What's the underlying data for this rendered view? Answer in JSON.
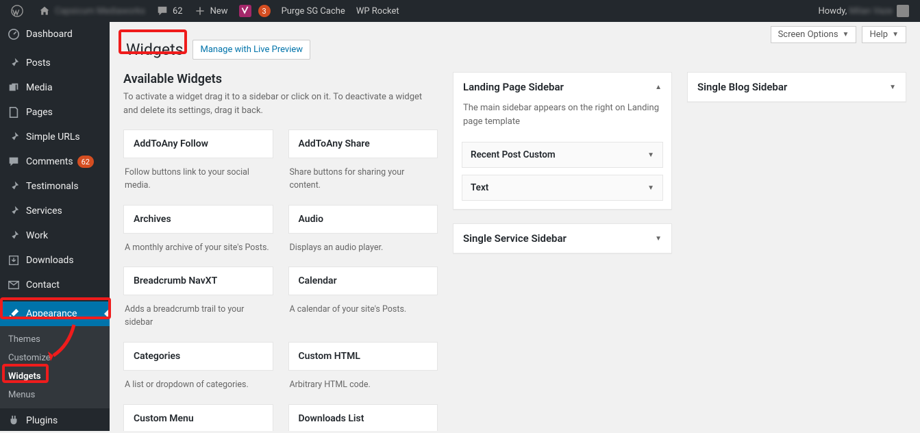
{
  "adminbar": {
    "site_name": "Capsicum Mediaworks",
    "comments_count": "62",
    "new_label": "New",
    "updates_count": "3",
    "purge_label": "Purge SG Cache",
    "wprocket_label": "WP Rocket",
    "howdy_prefix": "Howdy,",
    "user_display": "Milan Vaze"
  },
  "sidebar": {
    "dashboard": "Dashboard",
    "posts": "Posts",
    "media": "Media",
    "pages": "Pages",
    "simple_urls": "Simple URLs",
    "comments": "Comments",
    "comments_count": "62",
    "testimonials": "Testimonals",
    "services": "Services",
    "work": "Work",
    "downloads": "Downloads",
    "contact": "Contact",
    "appearance": "Appearance",
    "appearance_sub": {
      "themes": "Themes",
      "customize": "Customize",
      "widgets": "Widgets",
      "menus": "Menus"
    },
    "plugins": "Plugins"
  },
  "screen_options": "Screen Options",
  "help": "Help",
  "page_title": "Widgets",
  "preview_link": "Manage with Live Preview",
  "available": {
    "title": "Available Widgets",
    "desc": "To activate a widget drag it to a sidebar or click on it. To deactivate a widget and delete its settings, drag it back.",
    "widgets": [
      {
        "name": "AddToAny Follow",
        "desc": "Follow buttons link to your social media."
      },
      {
        "name": "AddToAny Share",
        "desc": "Share buttons for sharing your content."
      },
      {
        "name": "Archives",
        "desc": "A monthly archive of your site's Posts."
      },
      {
        "name": "Audio",
        "desc": "Displays an audio player."
      },
      {
        "name": "Breadcrumb NavXT",
        "desc": "Adds a breadcrumb trail to your sidebar"
      },
      {
        "name": "Calendar",
        "desc": "A calendar of your site's Posts."
      },
      {
        "name": "Categories",
        "desc": "A list or dropdown of categories."
      },
      {
        "name": "Custom HTML",
        "desc": "Arbitrary HTML code."
      },
      {
        "name": "Custom Menu",
        "desc": ""
      },
      {
        "name": "Downloads List",
        "desc": ""
      }
    ]
  },
  "sidebars": [
    {
      "title": "Landing Page Sidebar",
      "desc": "The main sidebar appears on the right on Landing page template",
      "expanded": true,
      "widgets": [
        {
          "name": "Recent Post Custom"
        },
        {
          "name": "Text"
        }
      ]
    },
    {
      "title": "Single Service Sidebar",
      "expanded": false
    },
    {
      "title": "Single Blog Sidebar",
      "expanded": false
    }
  ]
}
